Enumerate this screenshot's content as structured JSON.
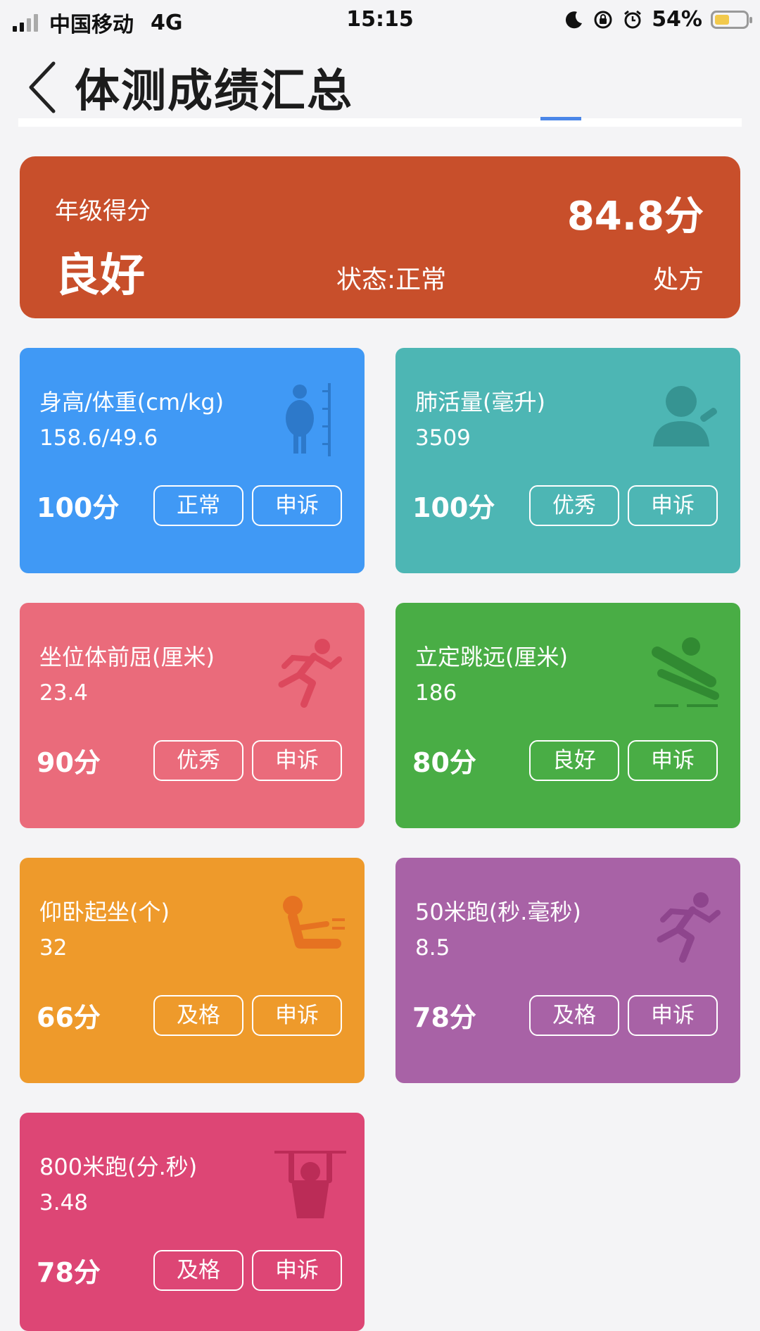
{
  "status_bar": {
    "carrier": "中国移动",
    "network": "4G",
    "time": "15:15",
    "battery": "54%",
    "battery_level": 0.54
  },
  "header": {
    "title": "体测成绩汇总",
    "back_icon": "chevron-left-icon"
  },
  "summary": {
    "label": "年级得分",
    "grade": "良好",
    "score": "84.8分",
    "status": "状态:正常",
    "prescription": "处方",
    "color": "#c84f2b"
  },
  "cards": [
    {
      "title": "身高/体重(cm/kg)",
      "value": "158.6/49.6",
      "score": "100分",
      "level": "正常",
      "appeal": "申诉",
      "color": "#4099f5",
      "icon": "height-weight-icon"
    },
    {
      "title": "肺活量(毫升)",
      "value": "3509",
      "score": "100分",
      "level": "优秀",
      "appeal": "申诉",
      "color": "#4db6b4",
      "icon": "lung-capacity-icon"
    },
    {
      "title": "坐位体前屈(厘米)",
      "value": "23.4",
      "score": "90分",
      "level": "优秀",
      "appeal": "申诉",
      "color": "#ea6b7b",
      "icon": "runner-icon"
    },
    {
      "title": "立定跳远(厘米)",
      "value": "186",
      "score": "80分",
      "level": "良好",
      "appeal": "申诉",
      "color": "#49ad45",
      "icon": "long-jump-icon"
    },
    {
      "title": "仰卧起坐(个)",
      "value": "32",
      "score": "66分",
      "level": "及格",
      "appeal": "申诉",
      "color": "#ee9a2b",
      "icon": "sit-up-icon"
    },
    {
      "title": "50米跑(秒.毫秒)",
      "value": "8.5",
      "score": "78分",
      "level": "及格",
      "appeal": "申诉",
      "color": "#a862a6",
      "icon": "sprint-icon"
    },
    {
      "title": "800米跑(分.秒)",
      "value": "3.48",
      "score": "78分",
      "level": "及格",
      "appeal": "申诉",
      "color": "#dd4675",
      "icon": "pull-up-icon"
    }
  ]
}
